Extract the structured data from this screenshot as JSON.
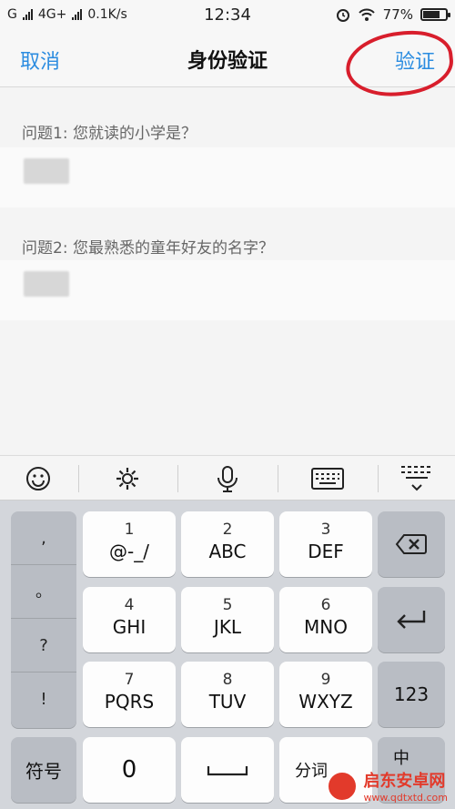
{
  "status_bar": {
    "carrier": "G",
    "network": "4G+",
    "speed": "0.1K/s",
    "time": "12:34",
    "battery": "77%",
    "battery_level": 0.77
  },
  "nav": {
    "cancel": "取消",
    "title": "身份验证",
    "verify": "验证"
  },
  "form": {
    "q1_label": "问题1: 您就读的小学是？",
    "q2_label": "问题2: 您最熟悉的童年好友的名字？"
  },
  "keyboard": {
    "toolbar_icons": [
      "emoji-icon",
      "settings-icon",
      "microphone-icon",
      "keyboard-icon",
      "keyboard-hide-icon"
    ],
    "punct": [
      ",",
      "。",
      "?",
      "!"
    ],
    "keys": {
      "k1_num": "1",
      "k1_letters": "@-_/",
      "k2_num": "2",
      "k2_letters": "ABC",
      "k3_num": "3",
      "k3_letters": "DEF",
      "k4_num": "4",
      "k4_letters": "GHI",
      "k5_num": "5",
      "k5_letters": "JKL",
      "k6_num": "6",
      "k6_letters": "MNO",
      "k7_num": "7",
      "k7_letters": "PQRS",
      "k8_num": "8",
      "k8_letters": "TUV",
      "k9_num": "9",
      "k9_letters": "WXYZ",
      "zero": "0",
      "symbols": "符号",
      "fenci": "分词",
      "num_mode": "123",
      "lang": "中"
    }
  },
  "watermark": {
    "name": "启东安卓网",
    "url": "www.qdtxtd.com"
  },
  "colors": {
    "accent": "#2b8ce0",
    "annotation": "#d81e2c"
  }
}
